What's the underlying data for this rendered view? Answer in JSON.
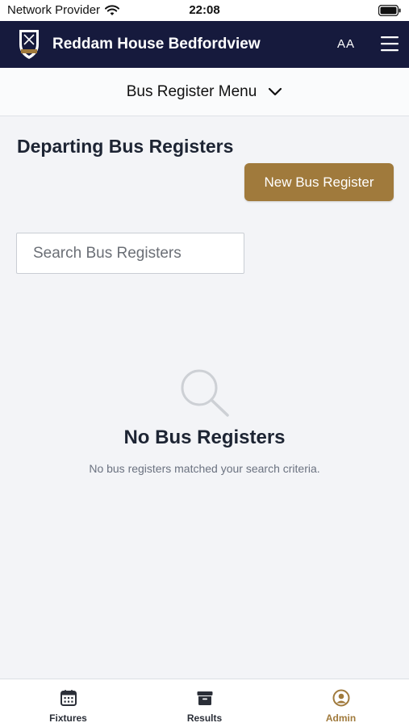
{
  "status_bar": {
    "carrier": "Network Provider",
    "time": "22:08"
  },
  "header": {
    "title": "Reddam House Bedfordview",
    "text_size_button": "AA",
    "logo_icon": "school-crest-icon",
    "menu_icon": "hamburger-icon"
  },
  "sub_menu": {
    "label": "Bus Register Menu",
    "icon": "chevron-down-icon"
  },
  "main": {
    "title": "Departing Bus Registers",
    "new_button_label": "New Bus Register",
    "search_placeholder": "Search Bus Registers",
    "empty_state": {
      "icon": "magnifier-icon",
      "title": "No Bus Registers",
      "description": "No bus registers matched your search criteria."
    }
  },
  "tabs": [
    {
      "label": "Fixtures",
      "icon": "calendar-icon",
      "active": false
    },
    {
      "label": "Results",
      "icon": "archive-box-icon",
      "active": false
    },
    {
      "label": "Admin",
      "icon": "user-circle-icon",
      "active": true
    }
  ],
  "colors": {
    "header_bg": "#161a3d",
    "accent": "#a07a3c",
    "page_bg": "#f3f4f7"
  }
}
